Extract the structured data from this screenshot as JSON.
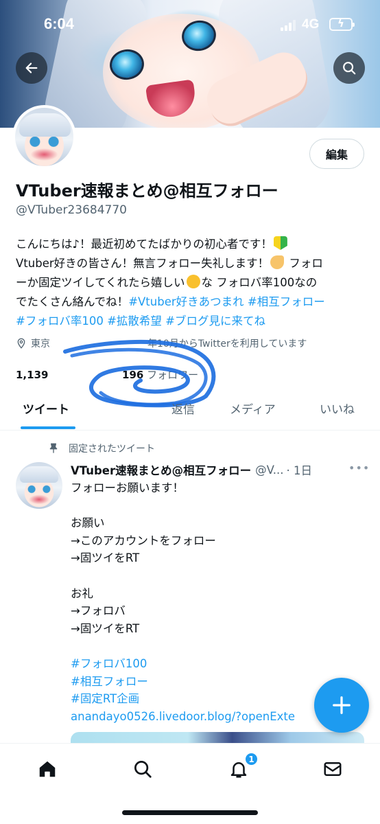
{
  "status_bar": {
    "time": "6:04",
    "network": "4G",
    "icons": [
      "signal-icon",
      "battery-charging-icon"
    ]
  },
  "header": {
    "back_icon": "arrow-left-icon",
    "search_icon": "search-icon"
  },
  "profile": {
    "edit_label": "編集",
    "display_name": "VTuber速報まとめ@相互フォロー",
    "handle": "@VTuber23684770",
    "bio": {
      "line1": "こんにちは♪！最近初めてたばかりの初心者です！",
      "line2a": "Vtuber好きの皆さん！無言フォロー失礼します！",
      "line2b": "フォロ",
      "line3a": "ーか固定ツイしてくれたら嬉しい",
      "line3b": "な フォロバ率100なの",
      "line4a": "でたくさん絡んでね！",
      "tag1": "#Vtuber好きあつまれ",
      "tag2": "#相互フォロー",
      "tag3": "#フォロバ率100",
      "tag4": "#拡散希望",
      "tag5": "#ブログ見に来てね"
    },
    "location": "東京",
    "joined_partial": "年10月からTwitterを利用しています",
    "following_count": "1,139",
    "followers_count": "196",
    "followers_label": "フォロワー"
  },
  "tabs": [
    {
      "label": "ツイート"
    },
    {
      "label": "返信"
    },
    {
      "label": "メディア"
    },
    {
      "label": "いいね"
    }
  ],
  "pinned_tweet": {
    "pinned_label": "固定されたツイート",
    "author_name": "VTuber速報まとめ@相互フォロー",
    "author_handle": "@V...",
    "time": "· 1日",
    "lines": [
      "フォローお願います！",
      "",
      "お願い",
      "→このアカウントをフォロー",
      "→固ツイをRT",
      "",
      "お礼",
      "→フォロバ",
      "→固ツイをRT",
      ""
    ],
    "hashtags": [
      "#フォロバ100",
      "#相互フォロー",
      "#固定RT企画"
    ],
    "link": "anandayo0526.livedoor.blog/?openExte"
  },
  "fab": {
    "icon": "plus-icon"
  },
  "bottom_nav": {
    "items": [
      "home-icon",
      "search-icon",
      "bell-icon",
      "mail-icon"
    ],
    "notification_badge": "1"
  },
  "colors": {
    "accent": "#1d9bf0",
    "scribble": "#1e6fe0",
    "text": "#0f1419",
    "secondary_text": "#536471"
  }
}
